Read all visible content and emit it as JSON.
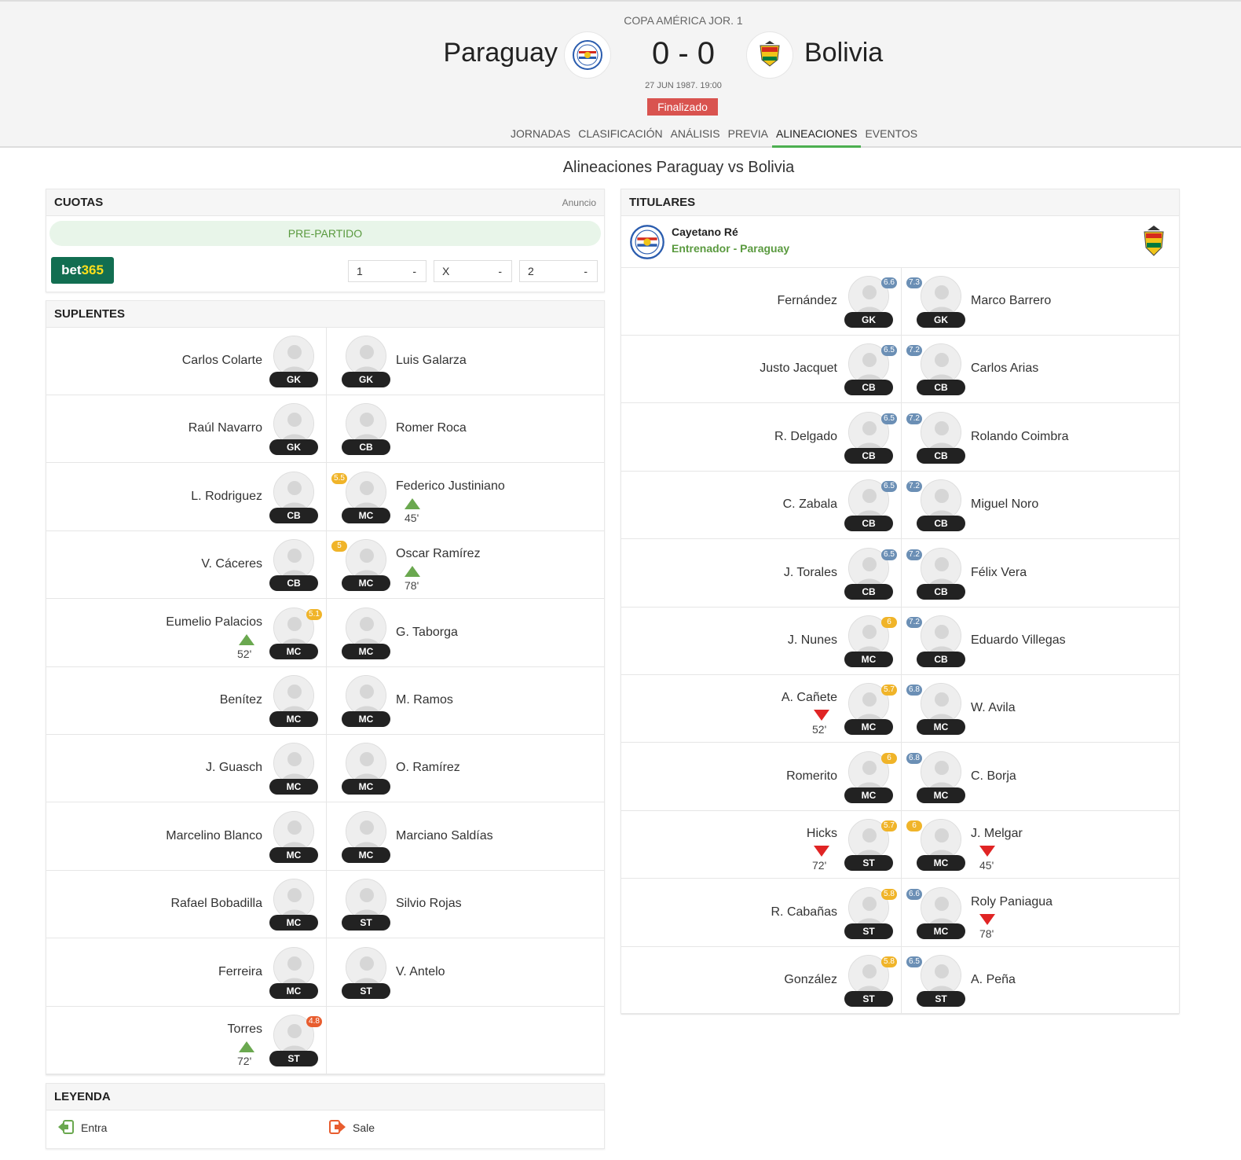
{
  "header": {
    "competition": "COPA AMÉRICA JOR. 1",
    "home": "Paraguay",
    "away": "Bolivia",
    "score": "0 - 0",
    "date": "27 JUN 1987. 19:00",
    "status": "Finalizado",
    "tabs": [
      "JORNADAS",
      "CLASIFICACIÓN",
      "ANÁLISIS",
      "PREVIA",
      "ALINEACIONES",
      "EVENTOS"
    ],
    "active_tab": "ALINEACIONES"
  },
  "page_title": "Alineaciones Paraguay vs Bolivia",
  "odds": {
    "title": "CUOTAS",
    "ad_label": "Anuncio",
    "phase": "PRE-PARTIDO",
    "bookmaker_a": "bet",
    "bookmaker_b": "365",
    "options": [
      {
        "label": "1",
        "value": "-"
      },
      {
        "label": "X",
        "value": "-"
      },
      {
        "label": "2",
        "value": "-"
      }
    ]
  },
  "subs": {
    "title": "SUPLENTES",
    "rows": [
      [
        {
          "name": "Carlos Colarte",
          "pos": "GK"
        },
        {
          "name": "Luis Galarza",
          "pos": "GK"
        }
      ],
      [
        {
          "name": "Raúl Navarro",
          "pos": "GK"
        },
        {
          "name": "Romer Roca",
          "pos": "CB"
        }
      ],
      [
        {
          "name": "L. Rodriguez",
          "pos": "CB"
        },
        {
          "name": "Federico Justiniano",
          "pos": "MC",
          "rating": "5.5",
          "rc": "y",
          "arrow": "up",
          "minute": "45'"
        }
      ],
      [
        {
          "name": "V. Cáceres",
          "pos": "CB"
        },
        {
          "name": "Oscar Ramírez",
          "pos": "MC",
          "rating": "5",
          "rc": "y",
          "arrow": "up",
          "minute": "78'"
        }
      ],
      [
        {
          "name": "Eumelio Palacios",
          "pos": "MC",
          "rating": "5.1",
          "rc": "y",
          "arrow": "up",
          "minute": "52'"
        },
        {
          "name": "G. Taborga",
          "pos": "MC"
        }
      ],
      [
        {
          "name": "Benítez",
          "pos": "MC"
        },
        {
          "name": "M. Ramos",
          "pos": "MC"
        }
      ],
      [
        {
          "name": "J. Guasch",
          "pos": "MC"
        },
        {
          "name": "O. Ramírez",
          "pos": "MC"
        }
      ],
      [
        {
          "name": "Marcelino Blanco",
          "pos": "MC"
        },
        {
          "name": "Marciano Saldías",
          "pos": "MC"
        }
      ],
      [
        {
          "name": "Rafael Bobadilla",
          "pos": "MC"
        },
        {
          "name": "Silvio Rojas",
          "pos": "ST"
        }
      ],
      [
        {
          "name": "Ferreira",
          "pos": "MC"
        },
        {
          "name": "V. Antelo",
          "pos": "ST"
        }
      ],
      [
        {
          "name": "Torres",
          "pos": "ST",
          "rating": "4.8",
          "rc": "o",
          "arrow": "up",
          "minute": "72'"
        },
        null
      ]
    ]
  },
  "legend": {
    "title": "LEYENDA",
    "in_label": "Entra",
    "out_label": "Sale"
  },
  "starters": {
    "title": "TITULARES",
    "coach_name": "Cayetano Ré",
    "coach_role": "Entrenador - Paraguay",
    "rows": [
      [
        {
          "name": "Fernández",
          "pos": "GK",
          "rating": "6.6",
          "rc": "b"
        },
        {
          "name": "Marco Barrero",
          "pos": "GK",
          "rating": "7.3",
          "rc": "b"
        }
      ],
      [
        {
          "name": "Justo Jacquet",
          "pos": "CB",
          "rating": "6.5",
          "rc": "b"
        },
        {
          "name": "Carlos Arias",
          "pos": "CB",
          "rating": "7.2",
          "rc": "b"
        }
      ],
      [
        {
          "name": "R. Delgado",
          "pos": "CB",
          "rating": "6.5",
          "rc": "b"
        },
        {
          "name": "Rolando Coimbra",
          "pos": "CB",
          "rating": "7.2",
          "rc": "b"
        }
      ],
      [
        {
          "name": "C. Zabala",
          "pos": "CB",
          "rating": "6.5",
          "rc": "b"
        },
        {
          "name": "Miguel Noro",
          "pos": "CB",
          "rating": "7.2",
          "rc": "b"
        }
      ],
      [
        {
          "name": "J. Torales",
          "pos": "CB",
          "rating": "6.5",
          "rc": "b"
        },
        {
          "name": "Félix Vera",
          "pos": "CB",
          "rating": "7.2",
          "rc": "b"
        }
      ],
      [
        {
          "name": "J. Nunes",
          "pos": "MC",
          "rating": "6",
          "rc": "y"
        },
        {
          "name": "Eduardo Villegas",
          "pos": "CB",
          "rating": "7.2",
          "rc": "b"
        }
      ],
      [
        {
          "name": "A. Cañete",
          "pos": "MC",
          "rating": "5.7",
          "rc": "y",
          "arrow": "down",
          "minute": "52'"
        },
        {
          "name": "W. Avila",
          "pos": "MC",
          "rating": "6.8",
          "rc": "b"
        }
      ],
      [
        {
          "name": "Romerito",
          "pos": "MC",
          "rating": "6",
          "rc": "y"
        },
        {
          "name": "C. Borja",
          "pos": "MC",
          "rating": "6.8",
          "rc": "b"
        }
      ],
      [
        {
          "name": "Hicks",
          "pos": "ST",
          "rating": "5.7",
          "rc": "y",
          "arrow": "down",
          "minute": "72'"
        },
        {
          "name": "J. Melgar",
          "pos": "MC",
          "rating": "6",
          "rc": "y",
          "arrow": "down",
          "minute": "45'"
        }
      ],
      [
        {
          "name": "R. Cabañas",
          "pos": "ST",
          "rating": "5.8",
          "rc": "y"
        },
        {
          "name": "Roly Paniagua",
          "pos": "MC",
          "rating": "6.6",
          "rc": "b",
          "arrow": "down",
          "minute": "78'"
        }
      ],
      [
        {
          "name": "González",
          "pos": "ST",
          "rating": "5.8",
          "rc": "y"
        },
        {
          "name": "A. Peña",
          "pos": "ST",
          "rating": "6.5",
          "rc": "b"
        }
      ]
    ]
  },
  "colors": {
    "accent": "#4caf50",
    "status": "#d9534f",
    "bet365_green": "#126e51",
    "in_arrow": "#6aa84f",
    "out_arrow": "#e02424"
  }
}
